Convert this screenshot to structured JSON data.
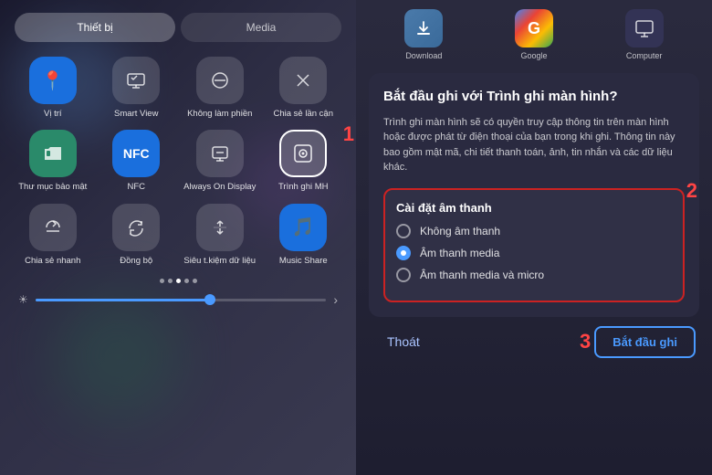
{
  "left": {
    "tab_thiet_bi": "Thiết bị",
    "tab_media": "Media",
    "icons": [
      {
        "id": "vi-tri",
        "label": "Vị trí",
        "color": "blue",
        "icon": "📍"
      },
      {
        "id": "smart-view",
        "label": "Smart View",
        "color": "gray",
        "icon": "📡"
      },
      {
        "id": "khong-lam-phien",
        "label": "Không\nlàm phiền",
        "color": "gray",
        "icon": "🚫"
      },
      {
        "id": "chia-se-lan-can",
        "label": "Chia sẻ lần\ncận",
        "color": "gray",
        "icon": "✕"
      },
      {
        "id": "thu-muc-bao-mat",
        "label": "Thư mục\nbảo mật",
        "color": "teal",
        "icon": "📁"
      },
      {
        "id": "nfc",
        "label": "NFC",
        "color": "blue",
        "icon": "N"
      },
      {
        "id": "always-on-display",
        "label": "Always On\nDisplay",
        "color": "gray",
        "icon": "💻"
      },
      {
        "id": "trinh-ghi-mh",
        "label": "Trình ghi MH",
        "color": "highlighted",
        "icon": "⊡"
      },
      {
        "id": "chia-se-nhanh",
        "label": "Chia sẻ\nnhanh",
        "color": "gray",
        "icon": "🔄"
      },
      {
        "id": "dong-bo",
        "label": "Đồng bộ",
        "color": "gray",
        "icon": "↻"
      },
      {
        "id": "sieu-tiet-kiem",
        "label": "Siêu t.kiệm\ndữ liệu",
        "color": "gray",
        "icon": "↑↓"
      },
      {
        "id": "music-share",
        "label": "Music Share",
        "color": "blue",
        "icon": "🎵"
      }
    ],
    "badge_1": "1",
    "dots": [
      false,
      false,
      true,
      false,
      false
    ]
  },
  "right": {
    "apps": [
      {
        "label": "Download",
        "type": "download"
      },
      {
        "label": "Google",
        "type": "grid"
      },
      {
        "label": "Computer",
        "type": "grid2"
      }
    ],
    "dialog": {
      "title": "Bắt đầu ghi với Trình ghi màn hình?",
      "description": "Trình ghi màn hình sẽ có quyền truy cập thông tin trên màn hình hoặc được phát từ điện thoại của bạn trong khi ghi. Thông tin này bao gồm mật mã, chi tiết thanh toán, ảnh, tin nhắn và các dữ liệu khác.",
      "audio_settings_title": "Cài đặt âm thanh",
      "options": [
        {
          "id": "no-sound",
          "label": "Không âm thanh",
          "selected": false
        },
        {
          "id": "media-sound",
          "label": "Âm thanh media",
          "selected": true
        },
        {
          "id": "media-micro",
          "label": "Âm thanh media và micro",
          "selected": false
        }
      ],
      "badge_2": "2",
      "btn_cancel": "Thoát",
      "btn_start": "Bắt đầu ghi",
      "badge_3": "3"
    }
  }
}
